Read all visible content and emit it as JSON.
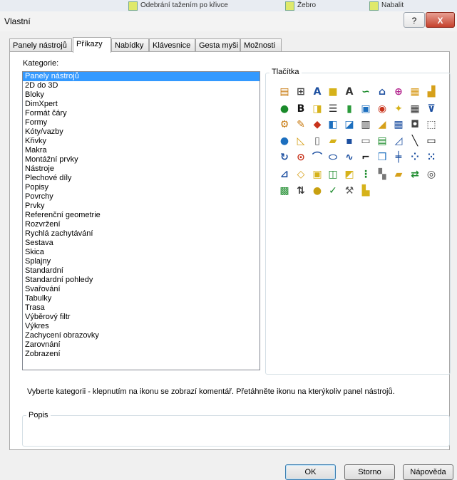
{
  "background_toolbar": {
    "items": [
      {
        "label": "Odebrání tažením po křivce"
      },
      {
        "label": "Žebro"
      },
      {
        "label": "Nabalit"
      }
    ]
  },
  "window": {
    "title": "Vlastní",
    "help_label": "?",
    "close_label": "X"
  },
  "tabs": [
    {
      "label": "Panely nástrojů"
    },
    {
      "label": "Příkazy",
      "active": true
    },
    {
      "label": "Nabídky"
    },
    {
      "label": "Klávesnice"
    },
    {
      "label": "Gesta myši"
    },
    {
      "label": "Možnosti"
    }
  ],
  "categories": {
    "label": "Kategorie:",
    "selected_index": 0,
    "items": [
      "Panely nástrojů",
      "2D do 3D",
      "Bloky",
      "DimXpert",
      "Formát čáry",
      "Formy",
      "Kóty/vazby",
      "Křivky",
      "Makra",
      "Montážní prvky",
      "Nástroje",
      "Plechové díly",
      "Popisy",
      "Povrchy",
      "Prvky",
      "Referenční geometrie",
      "Rozvržení",
      "Rychlá zachytávání",
      "Sestava",
      "Skica",
      "Splajny",
      "Standardní",
      "Standardní pohledy",
      "Svařování",
      "Tabulky",
      "Trasa",
      "Výběrový filtr",
      "Výkres",
      "Zachycení obrazovky",
      "Zarovnání",
      "Zobrazení"
    ]
  },
  "buttons_group": {
    "label": "Tlačítka",
    "icons": [
      {
        "name": "layers-icon",
        "glyph": "▤",
        "color": "#c87a10"
      },
      {
        "name": "linetype-icon",
        "glyph": "⊞",
        "color": "#444444"
      },
      {
        "name": "text-style-icon",
        "glyph": "A",
        "color": "#1c4fa0"
      },
      {
        "name": "cube-icon",
        "glyph": "■",
        "color": "#d6b21a"
      },
      {
        "name": "note-icon",
        "glyph": "A",
        "color": "#333333"
      },
      {
        "name": "spline-icon",
        "glyph": "∽",
        "color": "#1a8a2a"
      },
      {
        "name": "feature-icon",
        "glyph": "⌂",
        "color": "#1c4fa0"
      },
      {
        "name": "target-icon",
        "glyph": "⊕",
        "color": "#b3268e"
      },
      {
        "name": "grid-panel-icon",
        "glyph": "▦",
        "color": "#d89a1a"
      },
      {
        "name": "stairs-icon",
        "glyph": "▟",
        "color": "#d6a01a"
      },
      {
        "name": "globe-icon",
        "glyph": "●",
        "color": "#1a8a2a"
      },
      {
        "name": "bold-italic-icon",
        "glyph": "B",
        "color": "#111111"
      },
      {
        "name": "sheet-icon",
        "glyph": "◨",
        "color": "#d6b21a"
      },
      {
        "name": "list-lines-icon",
        "glyph": "☰",
        "color": "#222222"
      },
      {
        "name": "bar-color-icon",
        "glyph": "▮",
        "color": "#2a9a3a"
      },
      {
        "name": "part-icon",
        "glyph": "▣",
        "color": "#1c6fbf"
      },
      {
        "name": "circle-dot-icon",
        "glyph": "◉",
        "color": "#c8321a"
      },
      {
        "name": "wand-icon",
        "glyph": "✦",
        "color": "#d6b21a"
      },
      {
        "name": "table-grid-icon",
        "glyph": "▦",
        "color": "#333333"
      },
      {
        "name": "filter-icon",
        "glyph": "⊽",
        "color": "#1c4fa0"
      },
      {
        "name": "gear-box-icon",
        "glyph": "⚙",
        "color": "#c87a10"
      },
      {
        "name": "pencil-icon",
        "glyph": "✎",
        "color": "#c87a10"
      },
      {
        "name": "render-icon",
        "glyph": "◆",
        "color": "#c8321a"
      },
      {
        "name": "mirror-icon",
        "glyph": "◧",
        "color": "#1c6fbf"
      },
      {
        "name": "blocks-icon",
        "glyph": "◪",
        "color": "#1c6fbf"
      },
      {
        "name": "bar-chart-icon",
        "glyph": "▥",
        "color": "#333333"
      },
      {
        "name": "shapes-icon",
        "glyph": "◢",
        "color": "#d6a01a"
      },
      {
        "name": "spreadsheet-icon",
        "glyph": "▦",
        "color": "#1c4fa0"
      },
      {
        "name": "camera-icon",
        "glyph": "◘",
        "color": "#444444"
      },
      {
        "name": "document-box-icon",
        "glyph": "⬚",
        "color": "#444444"
      },
      {
        "name": "earth-icon",
        "glyph": "●",
        "color": "#1c6fbf"
      },
      {
        "name": "plane-icon",
        "glyph": "◺",
        "color": "#d6a01a"
      },
      {
        "name": "new-file-icon",
        "glyph": "▯",
        "color": "#555555"
      },
      {
        "name": "open-folder-icon",
        "glyph": "▰",
        "color": "#d6b21a"
      },
      {
        "name": "save-icon",
        "glyph": "▪",
        "color": "#1c4fa0"
      },
      {
        "name": "print-icon",
        "glyph": "▭",
        "color": "#555555"
      },
      {
        "name": "properties-icon",
        "glyph": "▤",
        "color": "#1a8a2a"
      },
      {
        "name": "sketch-line-icon",
        "glyph": "◿",
        "color": "#1c4fa0"
      },
      {
        "name": "line-icon",
        "glyph": "╲",
        "color": "#111111"
      },
      {
        "name": "rectangle-icon",
        "glyph": "▭",
        "color": "#111111"
      },
      {
        "name": "rotate-icon",
        "glyph": "↻",
        "color": "#1c4fa0"
      },
      {
        "name": "compass-icon",
        "glyph": "⊙",
        "color": "#c8321a"
      },
      {
        "name": "arc-icon",
        "glyph": "⌒",
        "color": "#1c4fa0"
      },
      {
        "name": "ellipse-icon",
        "glyph": "⬭",
        "color": "#1c4fa0"
      },
      {
        "name": "curve-icon",
        "glyph": "∿",
        "color": "#1c4fa0"
      },
      {
        "name": "corner-icon",
        "glyph": "⌐",
        "color": "#111111"
      },
      {
        "name": "box3d-icon",
        "glyph": "❒",
        "color": "#1c6fbf"
      },
      {
        "name": "split-icon",
        "glyph": "╪",
        "color": "#1c4fa0"
      },
      {
        "name": "points-icon",
        "glyph": "⁘",
        "color": "#1c4fa0"
      },
      {
        "name": "grid-dots-icon",
        "glyph": "⁙",
        "color": "#1c4fa0"
      },
      {
        "name": "measure-icon",
        "glyph": "⊿",
        "color": "#1c4fa0"
      },
      {
        "name": "tag-icon",
        "glyph": "◇",
        "color": "#d6a01a"
      },
      {
        "name": "frame-icon",
        "glyph": "▣",
        "color": "#d6b21a"
      },
      {
        "name": "layout-icon",
        "glyph": "◫",
        "color": "#1a8a2a"
      },
      {
        "name": "box-open-icon",
        "glyph": "◩",
        "color": "#d6b21a"
      },
      {
        "name": "array-icon",
        "glyph": "⋮",
        "color": "#1a8a2a"
      },
      {
        "name": "tiles-icon",
        "glyph": "▚",
        "color": "#777777"
      },
      {
        "name": "folder-arrow-icon",
        "glyph": "▰",
        "color": "#d6a01a"
      },
      {
        "name": "move-icon",
        "glyph": "⇄",
        "color": "#1a8a2a"
      },
      {
        "name": "eye-icon",
        "glyph": "◎",
        "color": "#444444"
      },
      {
        "name": "assembly-icon",
        "glyph": "▩",
        "color": "#1a8a2a"
      },
      {
        "name": "up-down-icon",
        "glyph": "⇅",
        "color": "#333333"
      },
      {
        "name": "sphere-icon",
        "glyph": "●",
        "color": "#c8a010"
      },
      {
        "name": "check-cut-icon",
        "glyph": "✓",
        "color": "#1a8a2a"
      },
      {
        "name": "tools-icon",
        "glyph": "⚒",
        "color": "#555555"
      },
      {
        "name": "build-icon",
        "glyph": "▙",
        "color": "#d6b21a"
      }
    ]
  },
  "hint_text": "Vyberte kategorii - klepnutím na ikonu se zobrazí komentář. Přetáhněte ikonu na kterýkoliv panel nástrojů.",
  "description": {
    "label": "Popis",
    "text": ""
  },
  "footer": {
    "ok_label": "OK",
    "cancel_label": "Storno",
    "help_label": "Nápověda"
  }
}
